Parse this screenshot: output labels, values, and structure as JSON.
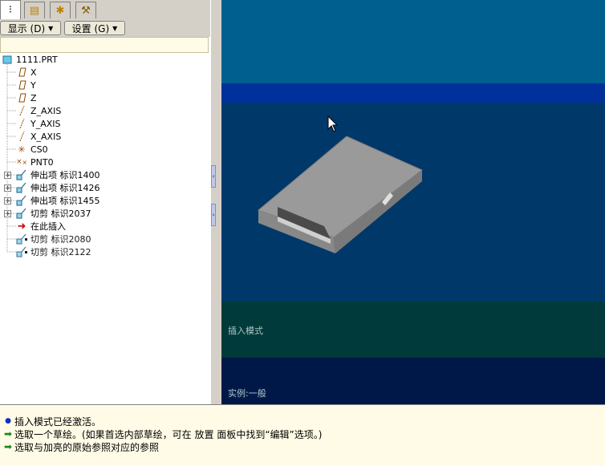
{
  "tabs": {
    "items": [
      {
        "icon": "model-tree-icon"
      },
      {
        "icon": "folder-layers-icon"
      },
      {
        "icon": "folder-star-icon"
      },
      {
        "icon": "tools-icon"
      }
    ]
  },
  "menus": {
    "show_label": "显示 (D)",
    "settings_label": "设置 (G)"
  },
  "tree": {
    "root": "1111.PRT",
    "items": [
      {
        "label": "X",
        "icon": "datum-plane-icon"
      },
      {
        "label": "Y",
        "icon": "datum-plane-icon"
      },
      {
        "label": "Z",
        "icon": "datum-plane-icon"
      },
      {
        "label": "Z_AXIS",
        "icon": "datum-axis-icon"
      },
      {
        "label": "Y_AXIS",
        "icon": "datum-axis-icon"
      },
      {
        "label": "X_AXIS",
        "icon": "datum-axis-icon"
      },
      {
        "label": "CS0",
        "icon": "coordinate-system-icon"
      },
      {
        "label": "PNT0",
        "icon": "datum-point-icon"
      },
      {
        "label": "伸出项 标识1400",
        "icon": "extrude-icon",
        "expand": true
      },
      {
        "label": "伸出项 标识1426",
        "icon": "extrude-icon",
        "expand": true
      },
      {
        "label": "伸出项 标识1455",
        "icon": "extrude-icon",
        "expand": true
      },
      {
        "label": "切剪 标识2037",
        "icon": "cut-icon",
        "expand": true
      },
      {
        "label": "在此插入",
        "icon": "insert-here-arrow-icon"
      },
      {
        "label": "切剪 标识2080",
        "icon": "cut-icon"
      },
      {
        "label": "切剪 标识2122",
        "icon": "cut-icon"
      }
    ]
  },
  "viewport": {
    "insert_mode": "插入模式",
    "instance": "实例:一般"
  },
  "messages": [
    {
      "text": "插入模式已经激活。",
      "icon": "info-dot-icon"
    },
    {
      "text": "选取一个草绘。(如果首选内部草绘，可在 放置 面板中找到“编辑”选项。)",
      "icon": "prompt-arrow-icon"
    },
    {
      "text": "选取与加亮的原始参照对应的参照",
      "icon": "prompt-arrow-icon"
    }
  ],
  "colors": {
    "view_top": "#005f8f",
    "view_band": "#00309a",
    "view_mid": "#00386a",
    "view_green": "#003a3a",
    "view_bottom": "#001848",
    "part": "#9a9a9a",
    "prompt": "#1a8a1a"
  }
}
